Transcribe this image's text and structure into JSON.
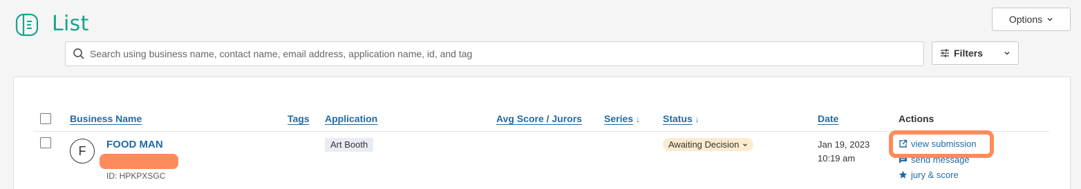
{
  "header": {
    "title": "List",
    "options_label": "Options",
    "search_placeholder": "Search using business name, contact name, email address, application name, id, and tag",
    "search_value": "",
    "filters_label": "Filters"
  },
  "table": {
    "columns": {
      "business_name": "Business Name",
      "tags": "Tags",
      "application": "Application",
      "avg_score": "Avg Score / Jurors",
      "series": "Series",
      "status": "Status",
      "date": "Date",
      "actions": "Actions"
    },
    "rows": [
      {
        "avatar_initial": "F",
        "business_name": "FOOD MAN",
        "id_text": "ID: HPKPXSGC",
        "application": "Art Booth",
        "status": "Awaiting Decision",
        "date": "Jan 19, 2023",
        "time": "10:19 am",
        "actions": {
          "view": "view submission",
          "message": "send message",
          "jury": "jury & score"
        }
      }
    ]
  },
  "colors": {
    "brand": "#19a38f",
    "link": "#1f6aa6",
    "highlight": "#ff8a5c",
    "status_badge": "#fbecd0",
    "tag_chip": "#e9ecf3"
  },
  "icons": {
    "page": "list-doc-icon",
    "search": "search-icon",
    "filters": "sliders-icon",
    "view": "external-link-icon",
    "message": "chat-icon",
    "jury": "star-icon"
  }
}
